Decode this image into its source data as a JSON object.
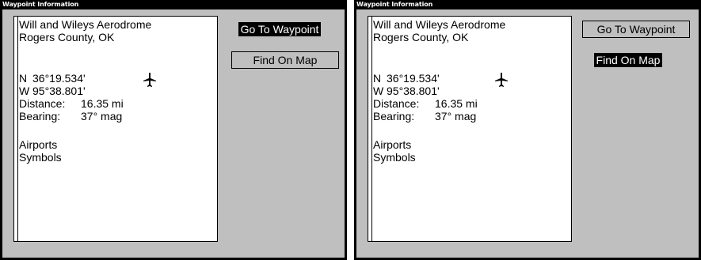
{
  "panels": [
    {
      "title": "Waypoint Information",
      "name_line1": "Will and Wileys Aerodrome",
      "name_line2": "Rogers County, OK",
      "lat_hemi": "N",
      "lat_value": "36°19.534'",
      "lon_hemi": "W",
      "lon_value": "95°38.801'",
      "distance_label": "Distance:",
      "distance_value": "16.35 mi",
      "bearing_label": "Bearing:",
      "bearing_value": "37° mag",
      "category": "Airports",
      "category2": "Symbols",
      "icon": "airplane-icon",
      "buttons": {
        "goto": "Go To Waypoint",
        "find": "Find On Map"
      },
      "selected_button": "goto"
    },
    {
      "title": "Waypoint Information",
      "name_line1": "Will and Wileys Aerodrome",
      "name_line2": "Rogers County, OK",
      "lat_hemi": "N",
      "lat_value": "36°19.534'",
      "lon_hemi": "W",
      "lon_value": "95°38.801'",
      "distance_label": "Distance:",
      "distance_value": "16.35 mi",
      "bearing_label": "Bearing:",
      "bearing_value": "37° mag",
      "category": "Airports",
      "category2": "Symbols",
      "icon": "airplane-icon",
      "buttons": {
        "goto": "Go To Waypoint",
        "find": "Find On Map"
      },
      "selected_button": "find"
    }
  ],
  "colors": {
    "frame": "#000000",
    "background": "#bfbfbf",
    "content": "#ffffff",
    "highlight": "#000000"
  }
}
